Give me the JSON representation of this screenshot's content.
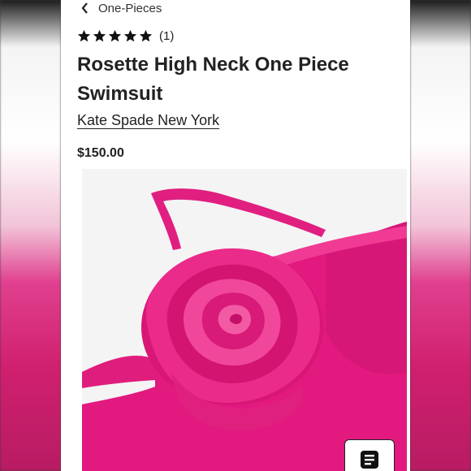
{
  "breadcrumb": {
    "label": "One-Pieces"
  },
  "rating": {
    "count_label": "(1)",
    "stars": 5
  },
  "product": {
    "title": "Rosette High Neck One Piece Swimsuit",
    "brand": "Kate Spade New York",
    "price": "$150.00"
  },
  "image": {
    "alt": "",
    "color": "#e2197f"
  },
  "icons": {
    "back": "chevron-left-icon",
    "star": "star-icon",
    "fab": "document-list-icon"
  }
}
